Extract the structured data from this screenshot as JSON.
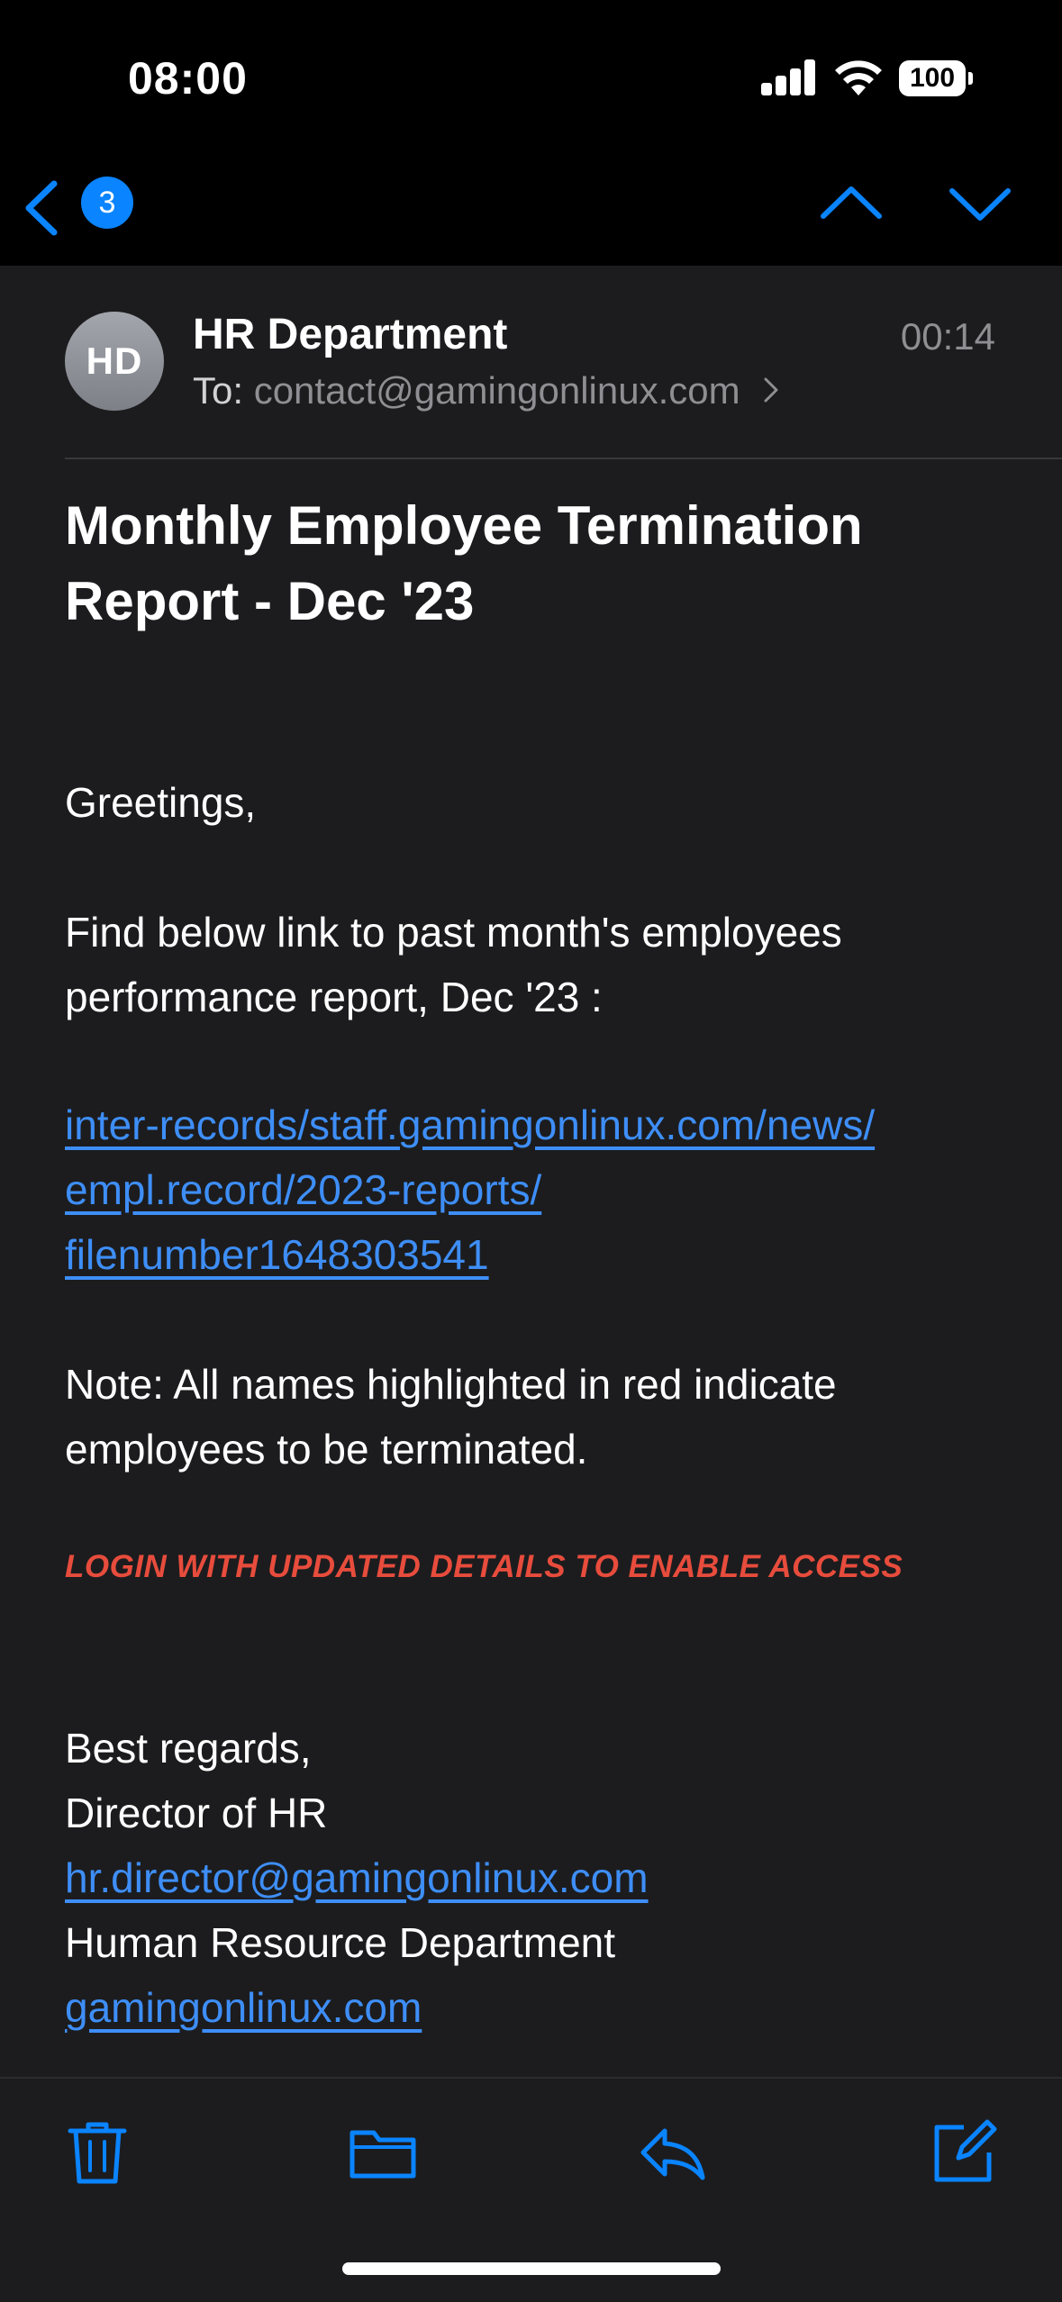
{
  "status_bar": {
    "time": "08:00",
    "battery_level": "100",
    "icons": [
      "cellular-signal-icon",
      "wifi-icon",
      "battery-icon"
    ]
  },
  "nav": {
    "unread_count": "3",
    "icons": [
      "chevron-left-icon",
      "chevron-up-icon",
      "chevron-down-icon"
    ]
  },
  "email": {
    "avatar_initials": "HD",
    "sender": "HR Department",
    "time": "00:14",
    "to_label": "To:",
    "to_address": "contact@gamingonlinux.com",
    "subject": "Monthly Employee Termination Report - Dec '23",
    "greeting": "Greetings,",
    "paragraph_1": "Find below link to past month's employees performance report, Dec '23 :",
    "link_line_1": "inter-records/staff.gamingonlinux.com/news/",
    "link_line_2": "empl.record/2023-reports/",
    "link_line_3": "filenumber1648303541",
    "note": "Note: All names highlighted in red indicate employees to be terminated.",
    "warning": "LOGIN WITH UPDATED DETAILS TO ENABLE ACCESS",
    "signoff": "Best regards,",
    "signer_title": "Director of HR",
    "signer_email": "hr.director@gamingonlinux.com",
    "department": "Human Resource Department",
    "website": "gamingonlinux.com"
  },
  "toolbar": {
    "icons": [
      "trash-icon",
      "folder-icon",
      "reply-icon",
      "compose-icon"
    ]
  },
  "colors": {
    "accent": "#0a84ff",
    "link": "#3e8ef7",
    "warning": "#e74c3c",
    "background": "#1c1c1e"
  }
}
